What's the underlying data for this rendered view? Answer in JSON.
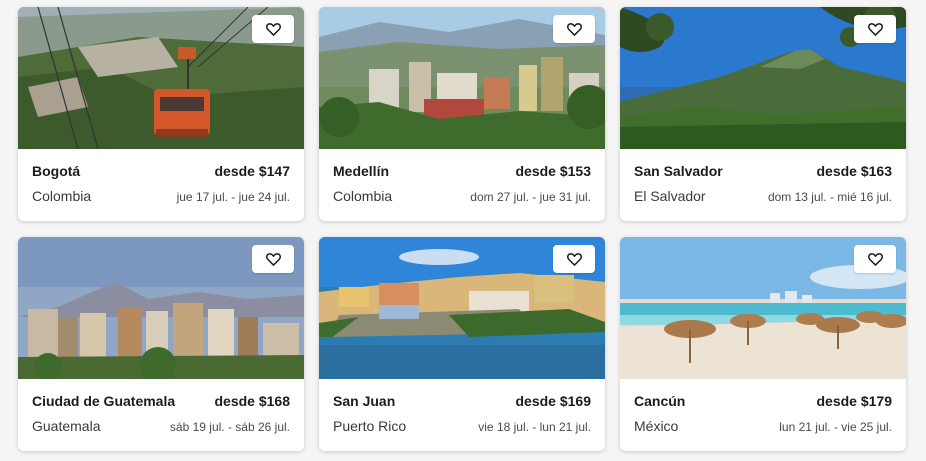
{
  "cards": [
    {
      "city": "Bogotá",
      "price": "desde $147",
      "country": "Colombia",
      "dates": "jue 17 jul. - jue 24 jul.",
      "image": "cable-car-mountain-photo"
    },
    {
      "city": "Medellín",
      "price": "desde $153",
      "country": "Colombia",
      "dates": "dom 27 jul. - jue 31 jul.",
      "image": "city-valley-photo"
    },
    {
      "city": "San Salvador",
      "price": "desde $163",
      "country": "El Salvador",
      "dates": "dom 13 jul. - mié 16 jul.",
      "image": "volcano-photo"
    },
    {
      "city": "Ciudad de Guatemala",
      "price": "desde $168",
      "country": "Guatemala",
      "dates": "sáb 19 jul. - sáb 26 jul.",
      "image": "city-skyline-volcano-photo"
    },
    {
      "city": "San Juan",
      "price": "desde $169",
      "country": "Puerto Rico",
      "dates": "vie 18 jul. - lun 21 jul.",
      "image": "coastal-old-town-photo"
    },
    {
      "city": "Cancún",
      "price": "desde $179",
      "country": "México",
      "dates": "lun 21 jul. - vie 25 jul.",
      "image": "beach-umbrellas-photo"
    }
  ],
  "icons": {
    "favorite": "heart-outline-icon"
  },
  "colors": {
    "card_bg": "#ffffff",
    "page_bg": "#f5f5f5",
    "text": "#1c1c1c"
  }
}
